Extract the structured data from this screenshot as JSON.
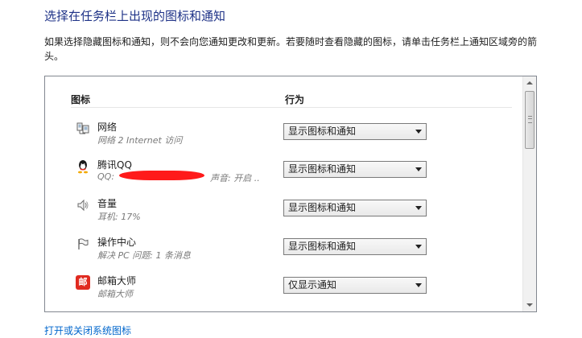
{
  "header": {
    "title": "选择在任务栏上出现的图标和通知",
    "description": "如果选择隐藏图标和通知，则不会向您通知更改和更新。若要随时查看隐藏的图标，请单击任务栏上通知区域旁的箭头。"
  },
  "table": {
    "col_icon": "图标",
    "col_behavior": "行为",
    "rows": [
      {
        "name": "网络",
        "sub": "网络 2 Internet 访问",
        "behavior": "显示图标和通知",
        "icon": "network-icon"
      },
      {
        "name": "腾讯QQ",
        "sub": "QQ:",
        "sub_extra": "声音: 开启 ..",
        "behavior": "显示图标和通知",
        "icon": "qq-icon"
      },
      {
        "name": "音量",
        "sub": "耳机: 17%",
        "behavior": "显示图标和通知",
        "icon": "speaker-icon"
      },
      {
        "name": "操作中心",
        "sub": "解决 PC 问题: 1 条消息",
        "behavior": "显示图标和通知",
        "icon": "flag-icon"
      },
      {
        "name": "邮箱大师",
        "sub": "邮箱大师",
        "behavior": "仅显示通知",
        "icon": "mail-master-icon",
        "icon_glyph": "邮"
      }
    ]
  },
  "footer": {
    "link": "打开或关闭系统图标"
  },
  "colors": {
    "title": "#1e3287",
    "link": "#0066cc",
    "redaction": "#ff1a1a"
  }
}
